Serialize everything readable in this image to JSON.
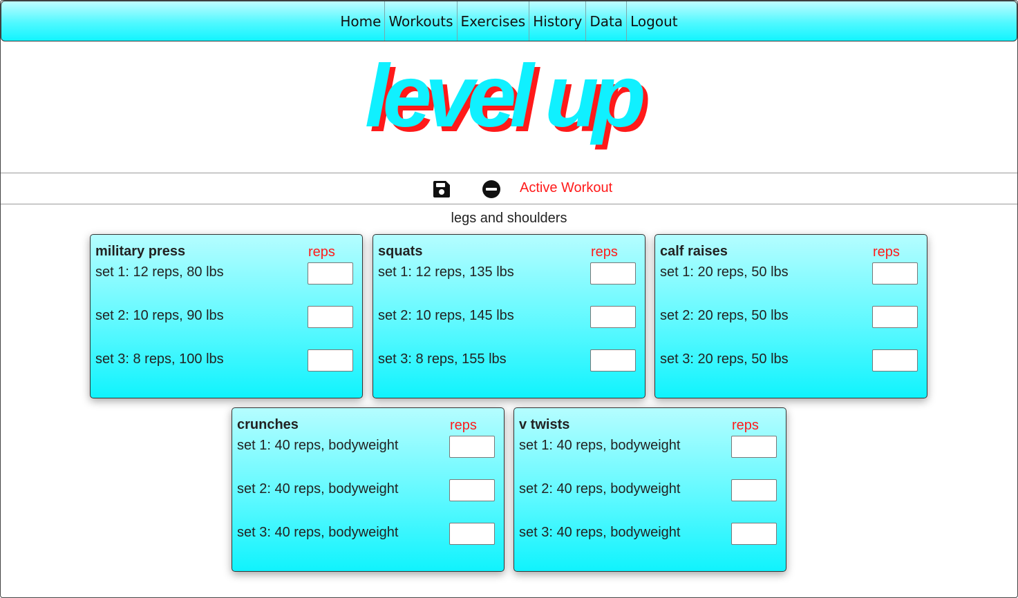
{
  "nav": {
    "items": [
      {
        "label": "Home"
      },
      {
        "label": "Workouts"
      },
      {
        "label": "Exercises"
      },
      {
        "label": "History"
      },
      {
        "label": "Data"
      },
      {
        "label": "Logout"
      }
    ]
  },
  "logo": {
    "text": "level up",
    "color": "#10f0ff",
    "shadow_color": "#ff1a1a"
  },
  "toolbar": {
    "save_icon": "floppy-disk-icon",
    "remove_icon": "minus-circle-icon",
    "active_label": "Active Workout"
  },
  "workout": {
    "name": "legs and shoulders",
    "exercises": [
      {
        "name": "military press",
        "reps_header": "reps",
        "sets": [
          {
            "label": "set 1: 12 reps, 80 lbs",
            "value": ""
          },
          {
            "label": "set 2: 10 reps, 90 lbs",
            "value": ""
          },
          {
            "label": "set 3: 8 reps, 100 lbs",
            "value": ""
          }
        ]
      },
      {
        "name": "squats",
        "reps_header": "reps",
        "sets": [
          {
            "label": "set 1: 12 reps, 135 lbs",
            "value": ""
          },
          {
            "label": "set 2: 10 reps, 145 lbs",
            "value": ""
          },
          {
            "label": "set 3: 8 reps, 155 lbs",
            "value": ""
          }
        ]
      },
      {
        "name": "calf raises",
        "reps_header": "reps",
        "sets": [
          {
            "label": "set 1: 20 reps, 50 lbs",
            "value": ""
          },
          {
            "label": "set 2: 20 reps, 50 lbs",
            "value": ""
          },
          {
            "label": "set 3: 20 reps, 50 lbs",
            "value": ""
          }
        ]
      },
      {
        "name": "crunches",
        "reps_header": "reps",
        "sets": [
          {
            "label": "set 1: 40 reps, bodyweight",
            "value": ""
          },
          {
            "label": "set 2: 40 reps, bodyweight",
            "value": ""
          },
          {
            "label": "set 3: 40 reps, bodyweight",
            "value": ""
          }
        ]
      },
      {
        "name": "v twists",
        "reps_header": "reps",
        "sets": [
          {
            "label": "set 1: 40 reps, bodyweight",
            "value": ""
          },
          {
            "label": "set 2: 40 reps, bodyweight",
            "value": ""
          },
          {
            "label": "set 3: 40 reps, bodyweight",
            "value": ""
          }
        ]
      }
    ]
  },
  "colors": {
    "accent": "#10f3fd",
    "active_red": "#ff1a1a"
  }
}
